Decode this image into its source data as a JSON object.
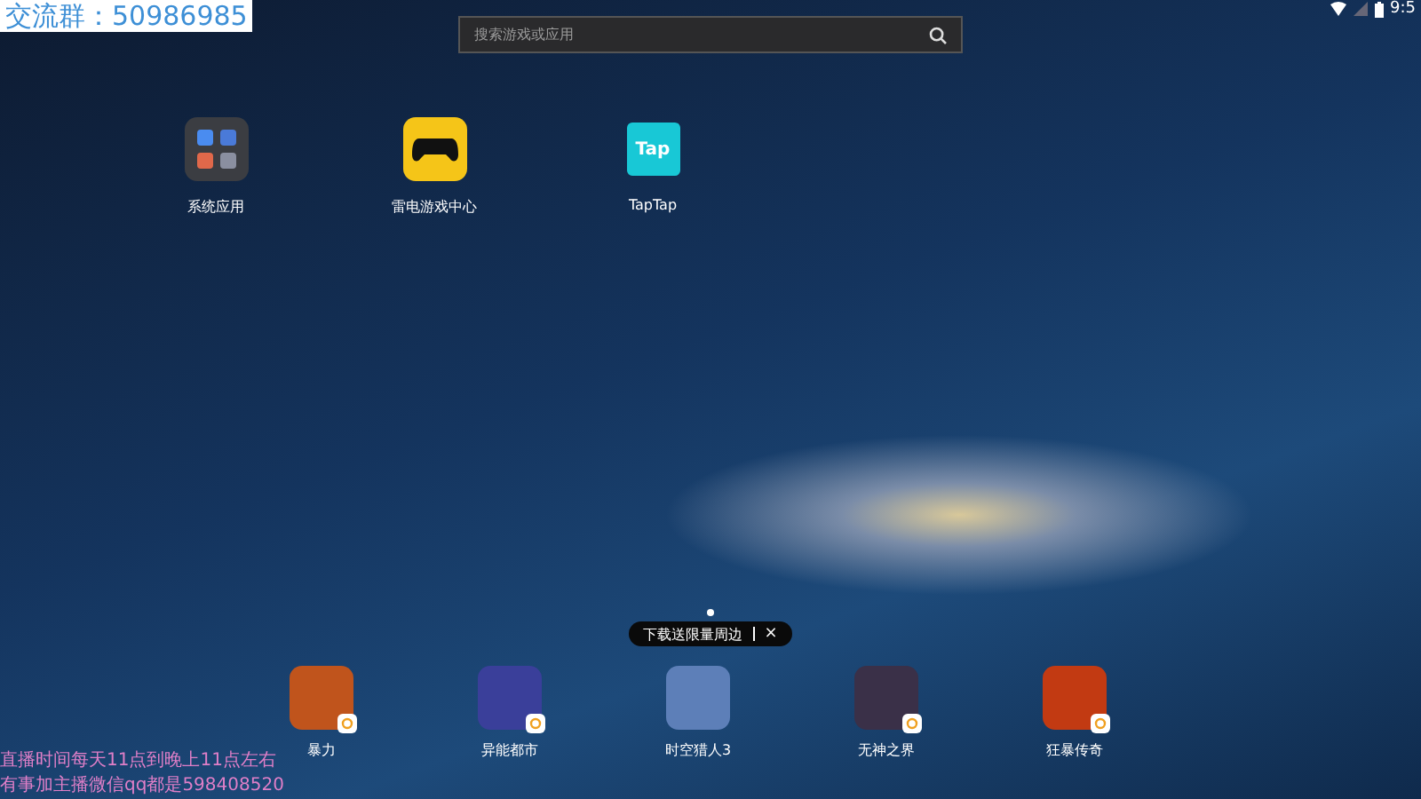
{
  "overlay": {
    "group_label": "交流群：50986985",
    "notice_lines": [
      "直播时间每天11点到晚上11点左右",
      "有事加主播微信qq都是598408520"
    ]
  },
  "status_bar": {
    "time": "9:5"
  },
  "search": {
    "placeholder": "搜索游戏或应用"
  },
  "desktop_apps": [
    {
      "label": "系统应用",
      "kind": "folder"
    },
    {
      "label": "雷电游戏中心",
      "kind": "gamepad"
    },
    {
      "label": "TapTap",
      "kind": "tap",
      "icon_text": "Tap"
    }
  ],
  "pager": {
    "dots": [
      {
        "selected": true
      }
    ]
  },
  "promo": {
    "text": "下载送限量周边",
    "close": "×"
  },
  "dock": [
    {
      "label": "暴力",
      "color": "#c0541c"
    },
    {
      "label": "异能都市",
      "color": "#3a3f9a"
    },
    {
      "label": "时空猎人3",
      "color": "#5d7fb8"
    },
    {
      "label": "无神之界",
      "color": "#3a3048"
    },
    {
      "label": "狂暴传奇",
      "color": "#c23a12"
    }
  ]
}
